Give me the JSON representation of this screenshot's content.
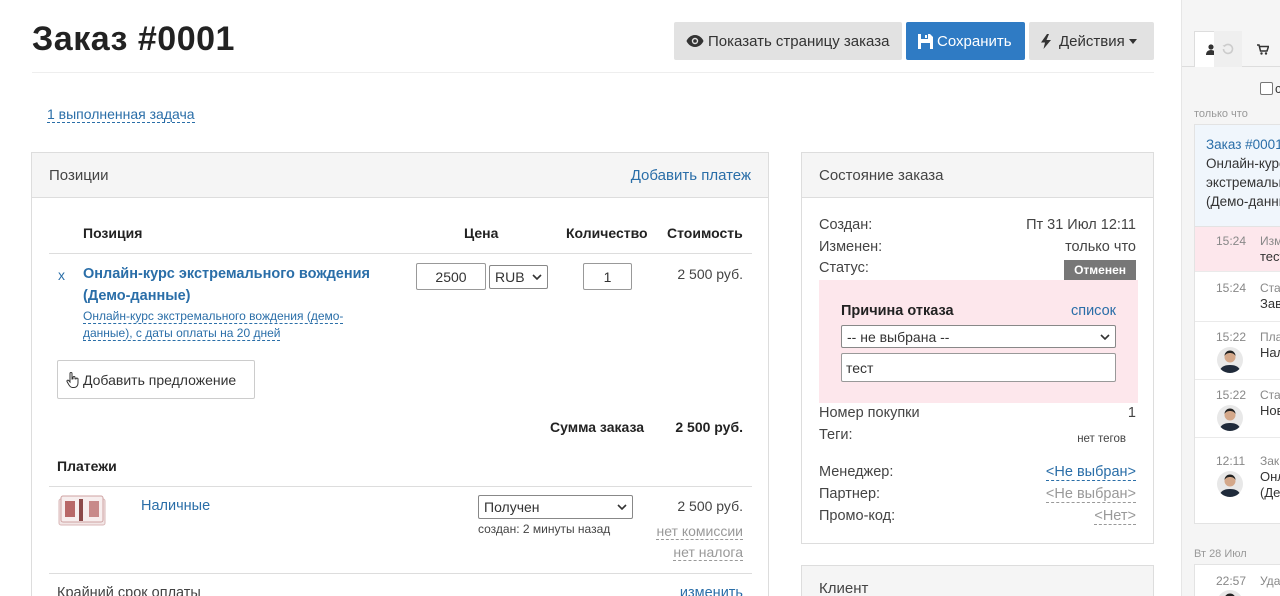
{
  "header": {
    "title": "Заказ #0001",
    "btn_show_order": "Показать страницу заказа",
    "btn_save": "Сохранить",
    "btn_actions": "Действия",
    "tasks_link": "1 выполненная задача"
  },
  "positions": {
    "heading": "Позиции",
    "add_payment": "Добавить платеж",
    "col_position": "Позиция",
    "col_price": "Цена",
    "col_qty": "Количество",
    "col_cost": "Стоимость",
    "item": {
      "remove": "x",
      "title": "Онлайн-курс экстремального вождения (Демо-данные)",
      "subtitle": "Онлайн-курс экстремального вождения (демо-данные), с даты оплаты на 20 дней",
      "price": "2500",
      "currency": "RUB",
      "qty": "1",
      "cost": "2 500 руб."
    },
    "add_offer": "Добавить предложение",
    "sum_label": "Сумма заказа",
    "sum_value": "2 500 руб.",
    "payments_title": "Платежи",
    "payment": {
      "method": "Наличные",
      "status": "Получен",
      "created": "создан: 2 минуты назад",
      "amount": "2 500 руб.",
      "commission": "нет комиссии",
      "tax": "нет налога"
    },
    "deadline_label": "Крайний срок оплаты",
    "deadline_change": "изменить"
  },
  "state": {
    "heading": "Состояние заказа",
    "created_label": "Создан:",
    "created_value": "Пт 31 Июл 12:11",
    "changed_label": "Изменен:",
    "changed_value": "только что",
    "status_label": "Статус:",
    "status_value": "Отменен",
    "reason_title": "Причина отказа",
    "reason_list": "список",
    "reason_select": "-- не выбрана --",
    "reason_input": "тест",
    "purchase_label": "Номер покупки",
    "purchase_value": "1",
    "tags_label": "Теги:",
    "tags_value": "нет тегов",
    "manager_label": "Менеджер:",
    "manager_value": "<Не выбран>",
    "partner_label": "Партнер:",
    "partner_value": "<Не выбран>",
    "promo_label": "Промо-код:",
    "promo_value": "<Нет>"
  },
  "client": {
    "heading": "Клиент"
  },
  "sidebar": {
    "checkbox_label": "с",
    "time_now": "только что",
    "feed_first_link": "Заказ #0001",
    "feed_first_text_1": "Онлайн-курс",
    "feed_first_text_2": "экстремальн",
    "feed_first_text_3": "(Демо-данны",
    "rows": [
      {
        "time": "15:24",
        "line1": "Изм",
        "line2": "тест"
      },
      {
        "time": "15:24",
        "line1": "Ста",
        "line2": "Зав"
      },
      {
        "time": "15:22",
        "line1": "Пла",
        "line2": "Нал"
      },
      {
        "time": "15:22",
        "line1": "Ста",
        "line2": "Нов"
      },
      {
        "time": "12:11",
        "line1": "Зак",
        "line2": "Онл",
        "line3": "(Де"
      }
    ],
    "date_label": "Вт 28 Июл",
    "row_last": {
      "time": "22:57",
      "line1": "Уда"
    }
  }
}
